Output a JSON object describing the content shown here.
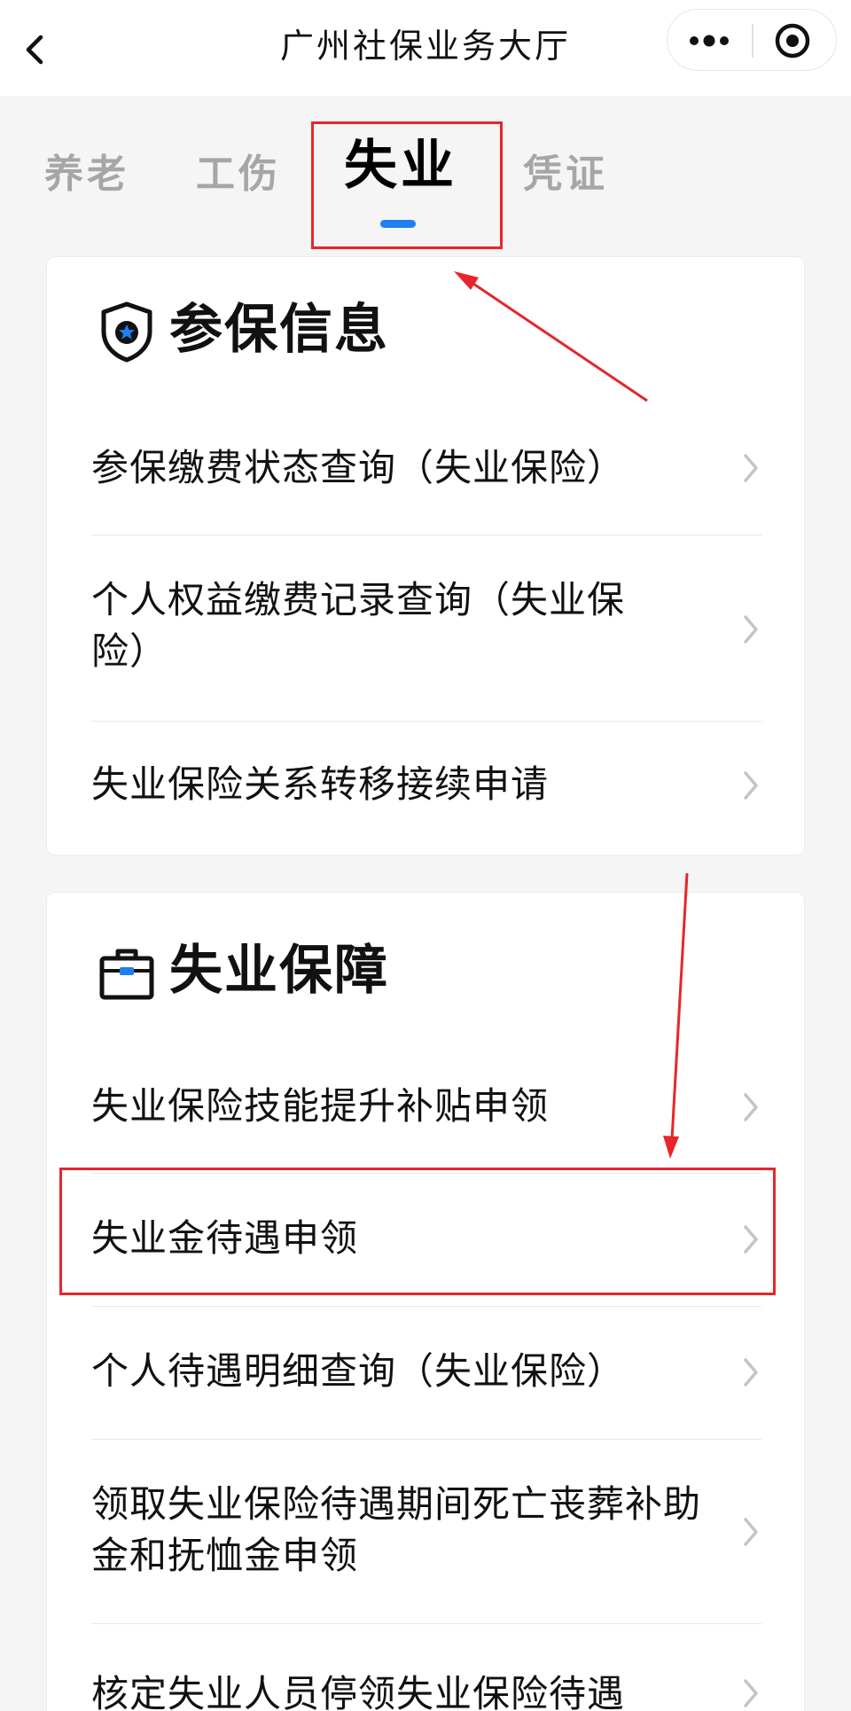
{
  "header": {
    "title": "广州社保业务大厅"
  },
  "tabs": [
    {
      "label": "养老",
      "active": false
    },
    {
      "label": "工伤",
      "active": false
    },
    {
      "label": "失业",
      "active": true
    },
    {
      "label": "凭证",
      "active": false
    }
  ],
  "sections": [
    {
      "title": "参保信息",
      "icon": "shield-star-icon",
      "items": [
        {
          "label": "参保缴费状态查询（失业保险）"
        },
        {
          "label": "个人权益缴费记录查询（失业保险）"
        },
        {
          "label": "失业保险关系转移接续申请"
        }
      ]
    },
    {
      "title": "失业保障",
      "icon": "briefcase-icon",
      "items": [
        {
          "label": "失业保险技能提升补贴申领"
        },
        {
          "label": "失业金待遇申领"
        },
        {
          "label": "个人待遇明细查询（失业保险）"
        },
        {
          "label": "领取失业保险待遇期间死亡丧葬补助金和抚恤金申领"
        },
        {
          "label": "核定失业人员停领失业保险待遇"
        }
      ]
    }
  ],
  "colors": {
    "accent": "#1f7ff2",
    "annotation": "#e8252a",
    "text": "#111111",
    "tab_inactive": "#a6a6a6"
  }
}
